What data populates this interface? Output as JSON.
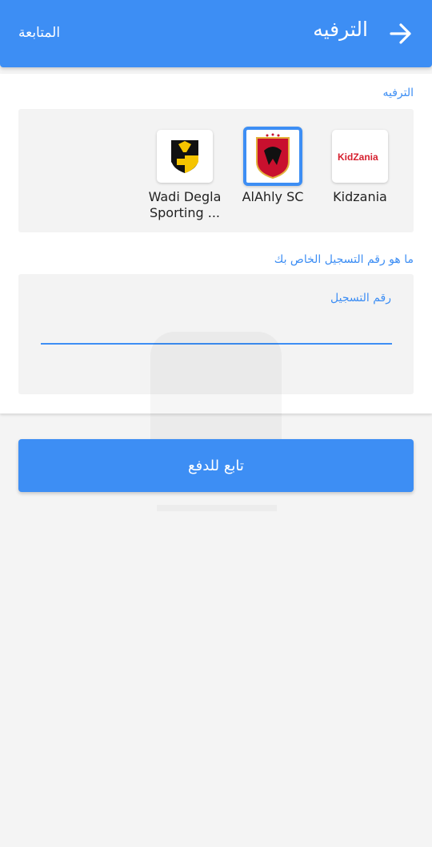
{
  "appbar": {
    "title": "الترفيه",
    "follow_label": "المتابعة",
    "back_icon": "arrow-right-icon"
  },
  "category_section": {
    "label": "الترفيه",
    "providers": [
      {
        "name": "Kidzania",
        "logo_text": "KidZania",
        "selected": false
      },
      {
        "name": "AlAhly SC",
        "selected": true
      },
      {
        "name": "Wadi Degla Sporting ...",
        "selected": false
      }
    ]
  },
  "registration": {
    "question": "ما هو رقم التسجيل الخاص بك",
    "field_label": "رقم التسجيل",
    "value": ""
  },
  "actions": {
    "pay_label": "تابع للدفع"
  },
  "colors": {
    "accent": "#3d8ef4",
    "background": "#f4f4f4"
  }
}
